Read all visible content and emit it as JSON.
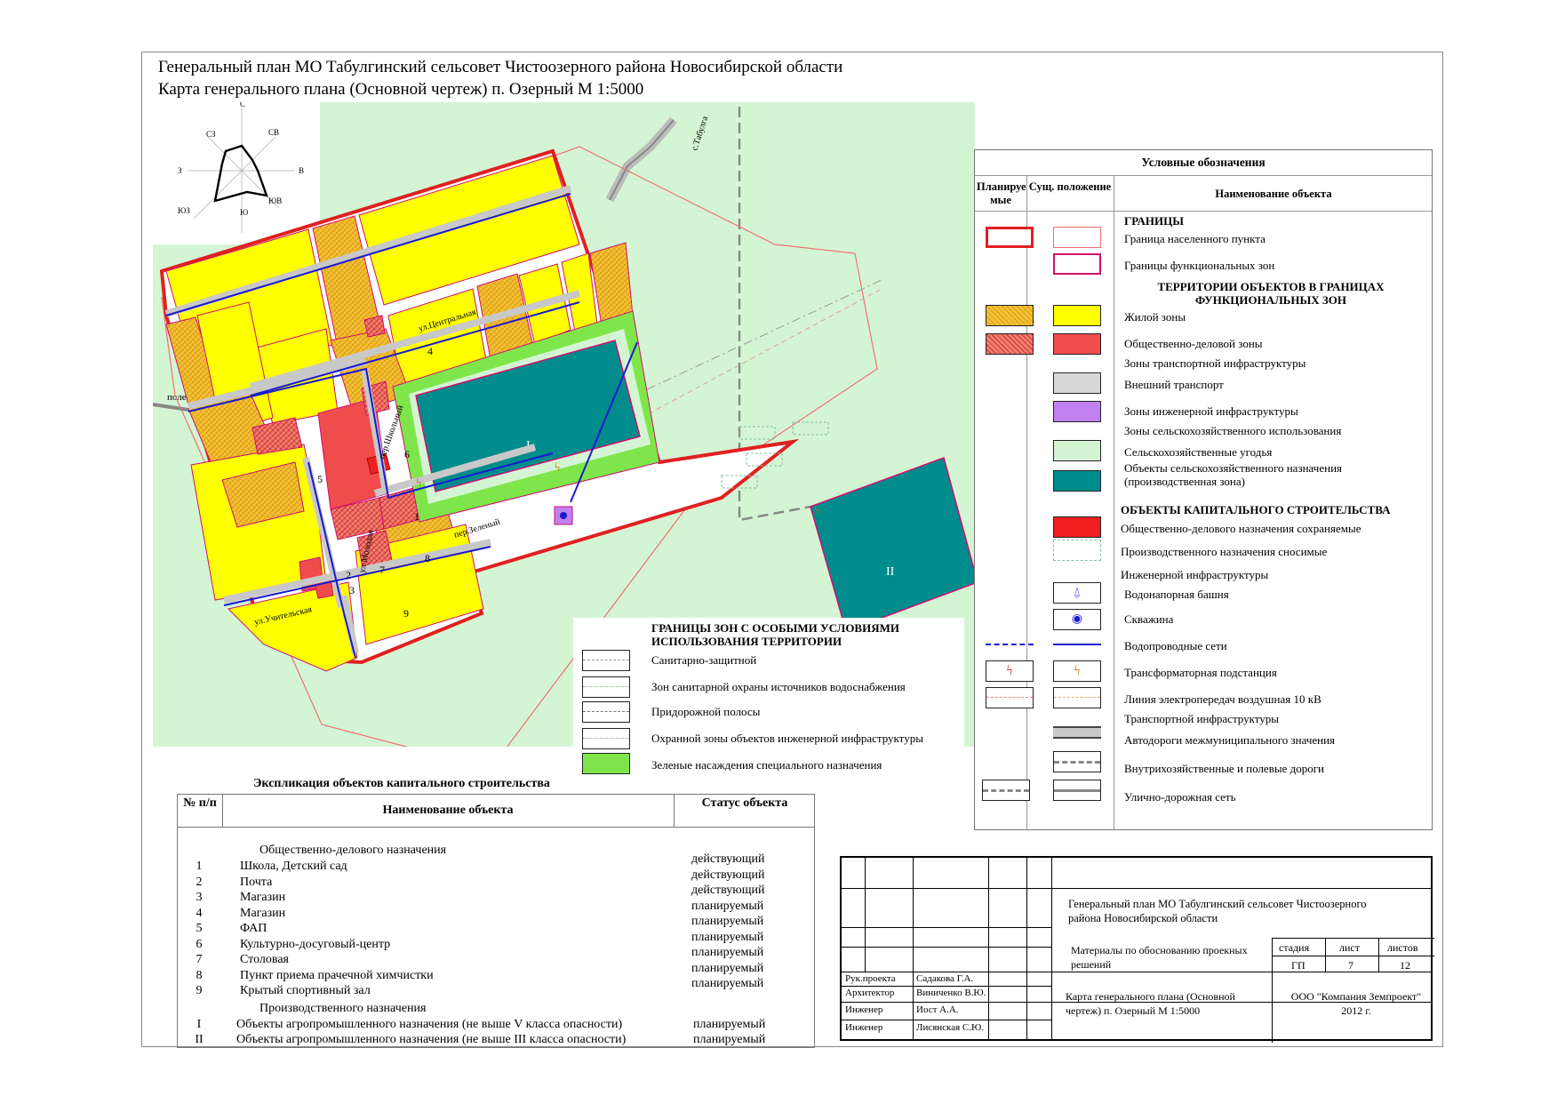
{
  "title": {
    "line1": "Генеральный план МО Табулгинский сельсовет Чистоозерного района Новосибирской области",
    "line2": "Карта генерального плана (Основной чертеж) п. Озерный М 1:5000"
  },
  "rose": {
    "n": "С",
    "ne": "СВ",
    "e": "В",
    "se": "ЮВ",
    "s": "Ю",
    "sw": "ЮЗ",
    "w": "З",
    "nw": "СЗ"
  },
  "map_labels": {
    "road_tabulga": "с.Табулга",
    "field": "поле",
    "st_central": "ул.Центральная",
    "st_school": "пер.Школьный",
    "st_youth": "ул.Молодая",
    "st_green": "пер.Зеленый",
    "st_teacher": "ул.Учительская",
    "obj": [
      "1",
      "2",
      "3",
      "4",
      "5",
      "6",
      "7",
      "8",
      "9"
    ],
    "zone_I": "I",
    "zone_II": "II"
  },
  "legend": {
    "title": "Условные обозначения",
    "col_planned": "Планируе мые",
    "col_existing": "Сущ. положение",
    "col_name": "Наименование объекта",
    "rows": {
      "h_borders": "ГРАНИЦЫ",
      "settlement": "Граница населенного пункта",
      "func_zones": "Границы функциональных зон",
      "h_territories": "ТЕРРИТОРИИ ОБЪЕКТОВ В ГРАНИЦАХ ФУНКЦИОНАЛЬНЫХ ЗОН",
      "residential": "Жилой зоны",
      "public": "Общественно-деловой зоны",
      "transport_zone": "Зоны транспортной инфраструктуры",
      "ext_transport": "Внешний транспорт",
      "eng_zone": "Зоны инженерной инфраструктуры",
      "agri_zone": "Зоны сельскохозяйственного использования",
      "agri_land": "Сельскохозяйственные угодья",
      "agri_objects": "Объекты сельскохозяйственного назначения (производственная зона)",
      "h_capital": "ОБЪЕКТЫ КАПИТАЛЬНОГО СТРОИТЕЛЬСТВА",
      "public_kept": "Общественно-делового назначения сохраняемые",
      "industrial_demolish": "Производственного назначения сносимые",
      "eng_infra": "Инженерной инфраструктуры",
      "water_tower": "Водонапорная башня",
      "well": "Скважина",
      "water_net": "Водопроводные сети",
      "transformer": "Трансформаторная подстанция",
      "power_line": "Линия электропередач воздушная 10 кВ",
      "transport_infra": "Транспортной инфраструктуры",
      "roads_inter": "Автодороги межмуниципального значения",
      "roads_field": "Внутрихозяйственные и полевые дороги",
      "street_net": "Улично-дорожная сеть"
    }
  },
  "zones": {
    "title": "ГРАНИЦЫ ЗОН С ОСОБЫМИ УСЛОВИЯМИ ИСПОЛЬЗОВАНИЯ ТЕРРИТОРИИ",
    "items": [
      "Санитарно-защитной",
      "Зон санитарной охраны источников водоснабжения",
      "Придорожной полосы",
      "Охранной зоны объектов инженерной инфраструктуры",
      "Зеленые насаждения специального назначения"
    ]
  },
  "explication": {
    "title": "Экспликация объектов капитального строительства",
    "col_num": "№ п/п",
    "col_name": "Наименование объекта",
    "col_status": "Статус объекта",
    "group1": "Общественно-делового назначения",
    "rows1": [
      {
        "n": "1",
        "name": "Школа, Детский сад",
        "status": "действующий"
      },
      {
        "n": "2",
        "name": "Почта",
        "status": "действующий"
      },
      {
        "n": "3",
        "name": "Магазин",
        "status": "действующий"
      },
      {
        "n": "4",
        "name": "Магазин",
        "status": "планируемый"
      },
      {
        "n": "5",
        "name": "ФАП",
        "status": "планируемый"
      },
      {
        "n": "6",
        "name": "Культурно-досуговый-центр",
        "status": "планируемый"
      },
      {
        "n": "7",
        "name": "Столовая",
        "status": "планируемый"
      },
      {
        "n": "8",
        "name": "Пункт приема прачечной химчистки",
        "status": "планируемый"
      },
      {
        "n": "9",
        "name": "Крытый спортивный зал",
        "status": "планируемый"
      }
    ],
    "group2": "Производственного назначения",
    "rows2": [
      {
        "n": "I",
        "name": "Объекты агропромышленного назначения (не выше V класса опасности)",
        "status": "планируемый"
      },
      {
        "n": "II",
        "name": "Объекты агропромышленного назначения (не выше III класса опасности)",
        "status": "планируемый"
      }
    ]
  },
  "stamp": {
    "project": "Генеральный план МО Табулгинский сельсовет Чистоозерного района Новосибирской области",
    "materials": "Материалы по обоснованию проекных решений",
    "stage_h": "стадия",
    "sheet_h": "лист",
    "sheets_h": "листов",
    "stage": "ГП",
    "sheet": "7",
    "sheets": "12",
    "roles": [
      {
        "role": "Рук.проекта",
        "name": "Садакова Г.А."
      },
      {
        "role": "Архитектор",
        "name": "Виниченко В.Ю."
      },
      {
        "role": "Инженер",
        "name": "Иост А.А."
      },
      {
        "role": "Инженер",
        "name": "Лисянская С.Ю."
      }
    ],
    "drawing": "Карта генерального плана (Основной чертеж) п. Озерный М 1:5000",
    "org": "ООО \"Компания Земпроект\" 2012 г."
  },
  "colors": {
    "residential": "#ffff00",
    "residential_planned": "#f2c230",
    "public": "#f04c4c",
    "public_planned": "#f08070",
    "agri_land": "#d4f5d4",
    "agri_objects": "#008c8c",
    "green": "#7ee64a",
    "boundary": "#e02020",
    "func_border": "#d01070",
    "water": "#1a1ad0",
    "road": "#c8c8c8",
    "eng": "#c080f0"
  }
}
